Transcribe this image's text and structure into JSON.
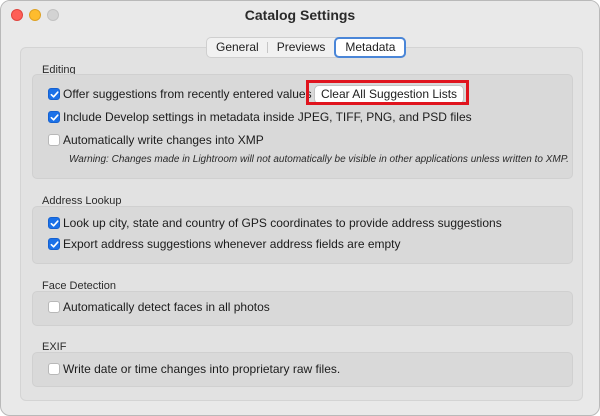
{
  "window": {
    "title": "Catalog Settings"
  },
  "tabs": [
    {
      "label": "General",
      "active": false
    },
    {
      "label": "Previews",
      "active": false
    },
    {
      "label": "Metadata",
      "active": true
    }
  ],
  "editing": {
    "label": "Editing",
    "offer_suggestions": {
      "label": "Offer suggestions from recently entered values",
      "checked": true
    },
    "clear_button": "Clear All Suggestion Lists",
    "include_develop": {
      "label": "Include Develop settings in metadata inside JPEG, TIFF, PNG, and PSD files",
      "checked": true
    },
    "auto_write_xmp": {
      "label": "Automatically write changes into XMP",
      "checked": false
    },
    "warning": "Warning: Changes made in Lightroom will not automatically be visible in other applications unless written to XMP."
  },
  "address_lookup": {
    "label": "Address Lookup",
    "lookup_gps": {
      "label": "Look up city, state and country of GPS coordinates to provide address suggestions",
      "checked": true
    },
    "export_suggestions": {
      "label": "Export address suggestions whenever address fields are empty",
      "checked": true
    }
  },
  "face_detection": {
    "label": "Face Detection",
    "auto_detect": {
      "label": "Automatically detect faces in all photos",
      "checked": false
    }
  },
  "exif": {
    "label": "EXIF",
    "write_date": {
      "label": "Write date or time changes into proprietary raw files.",
      "checked": false
    }
  },
  "colors": {
    "accent": "#1b71e8",
    "highlight": "#e0141e"
  }
}
